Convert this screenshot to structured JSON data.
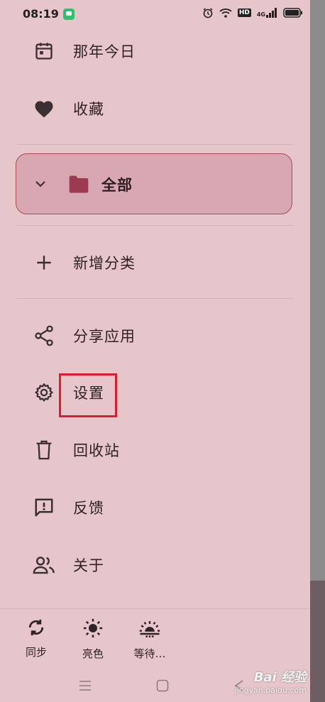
{
  "status_bar": {
    "time": "08:19",
    "hd_label": "HD",
    "network_label": "4G",
    "icons": [
      "chat-app-icon",
      "alarm-icon",
      "wifi-icon",
      "hd-icon",
      "signal-icon",
      "battery-icon"
    ]
  },
  "menu": {
    "items": [
      {
        "label": "那年今日",
        "icon": "calendar-icon"
      },
      {
        "label": "收藏",
        "icon": "heart-icon"
      },
      {
        "label": "新增分类",
        "icon": "plus-icon"
      },
      {
        "label": "分享应用",
        "icon": "share-icon"
      },
      {
        "label": "设置",
        "icon": "gear-icon"
      },
      {
        "label": "回收站",
        "icon": "trash-icon"
      },
      {
        "label": "反馈",
        "icon": "feedback-icon"
      },
      {
        "label": "关于",
        "icon": "people-icon"
      }
    ],
    "category": {
      "label": "全部",
      "icon": "folder-icon",
      "expanded": true
    }
  },
  "bottom_bar": {
    "buttons": [
      {
        "label": "同步",
        "icon": "sync-icon"
      },
      {
        "label": "亮色",
        "icon": "sun-icon"
      },
      {
        "label": "等待…",
        "icon": "sunrise-icon"
      }
    ]
  },
  "nav_bar": {
    "icons": [
      "menu-nav-icon",
      "home-nav-icon",
      "back-nav-icon"
    ]
  },
  "colors": {
    "drawer_bg": "#e6c5cb",
    "accent": "#a8485e",
    "selected_bg": "#d9a7b2",
    "highlight": "#e21a2e",
    "icon": "#3a2f33"
  },
  "watermark": {
    "brand": "Bai 经验",
    "url": "jingyan.baidu.com"
  }
}
